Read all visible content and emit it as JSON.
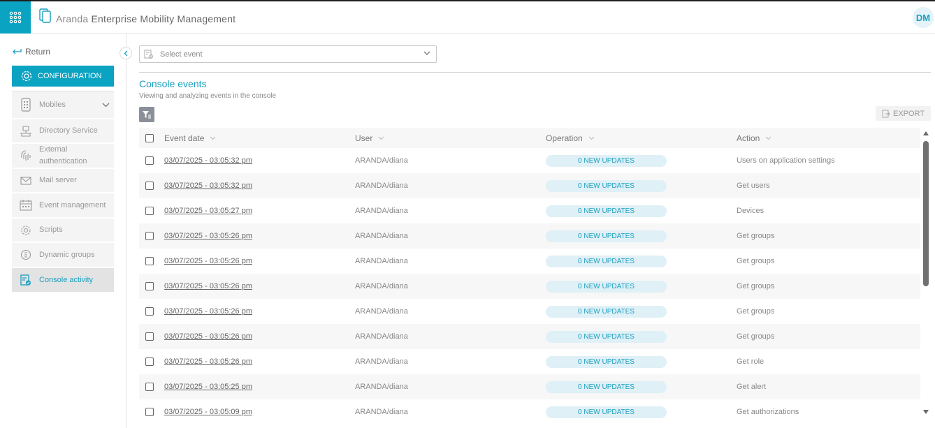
{
  "app": {
    "title_prefix": "Aranda",
    "title_main": "Enterprise Mobility Management",
    "user_initials": "DM"
  },
  "sidebar": {
    "return_label": "Return",
    "config_label": "CONFIGURATION",
    "items": [
      {
        "label": "Mobiles",
        "icon": "mobile-icon"
      },
      {
        "label": "Directory Service",
        "icon": "directory-icon"
      },
      {
        "label": "External authentication",
        "icon": "fingerprint-icon"
      },
      {
        "label": "Mail server",
        "icon": "mail-icon"
      },
      {
        "label": "Event management",
        "icon": "calendar-icon"
      },
      {
        "label": "Scripts",
        "icon": "gear-icon"
      },
      {
        "label": "Dynamic groups",
        "icon": "dynamic-groups-icon"
      },
      {
        "label": "Console activity",
        "icon": "console-activity-icon"
      }
    ]
  },
  "filter": {
    "select_placeholder": "Select event"
  },
  "main": {
    "title": "Console events",
    "subtitle": "Viewing and analyzing events in the console",
    "export_label": "EXPORT"
  },
  "table": {
    "columns": [
      "Event date",
      "User",
      "Operation",
      "Action"
    ],
    "rows": [
      {
        "date": "03/07/2025 - 03:05:32 pm",
        "user": "ARANDA/diana",
        "operation": "0 NEW UPDATES",
        "action": "Users on application settings"
      },
      {
        "date": "03/07/2025 - 03:05:32 pm",
        "user": "ARANDA/diana",
        "operation": "0 NEW UPDATES",
        "action": "Get users"
      },
      {
        "date": "03/07/2025 - 03:05:27 pm",
        "user": "ARANDA/diana",
        "operation": "0 NEW UPDATES",
        "action": "Devices"
      },
      {
        "date": "03/07/2025 - 03:05:26 pm",
        "user": "ARANDA/diana",
        "operation": "0 NEW UPDATES",
        "action": "Get groups"
      },
      {
        "date": "03/07/2025 - 03:05:26 pm",
        "user": "ARANDA/diana",
        "operation": "0 NEW UPDATES",
        "action": "Get groups"
      },
      {
        "date": "03/07/2025 - 03:05:26 pm",
        "user": "ARANDA/diana",
        "operation": "0 NEW UPDATES",
        "action": "Get groups"
      },
      {
        "date": "03/07/2025 - 03:05:26 pm",
        "user": "ARANDA/diana",
        "operation": "0 NEW UPDATES",
        "action": "Get groups"
      },
      {
        "date": "03/07/2025 - 03:05:26 pm",
        "user": "ARANDA/diana",
        "operation": "0 NEW UPDATES",
        "action": "Get groups"
      },
      {
        "date": "03/07/2025 - 03:05:26 pm",
        "user": "ARANDA/diana",
        "operation": "0 NEW UPDATES",
        "action": "Get role"
      },
      {
        "date": "03/07/2025 - 03:05:25 pm",
        "user": "ARANDA/diana",
        "operation": "0 NEW UPDATES",
        "action": "Get alert"
      },
      {
        "date": "03/07/2025 - 03:05:09 pm",
        "user": "ARANDA/diana",
        "operation": "0 NEW UPDATES",
        "action": "Get authorizations"
      }
    ]
  },
  "colors": {
    "accent": "#0aa3c2",
    "accent_text": "#1a9fc0",
    "badge_bg": "#dff0f6"
  }
}
